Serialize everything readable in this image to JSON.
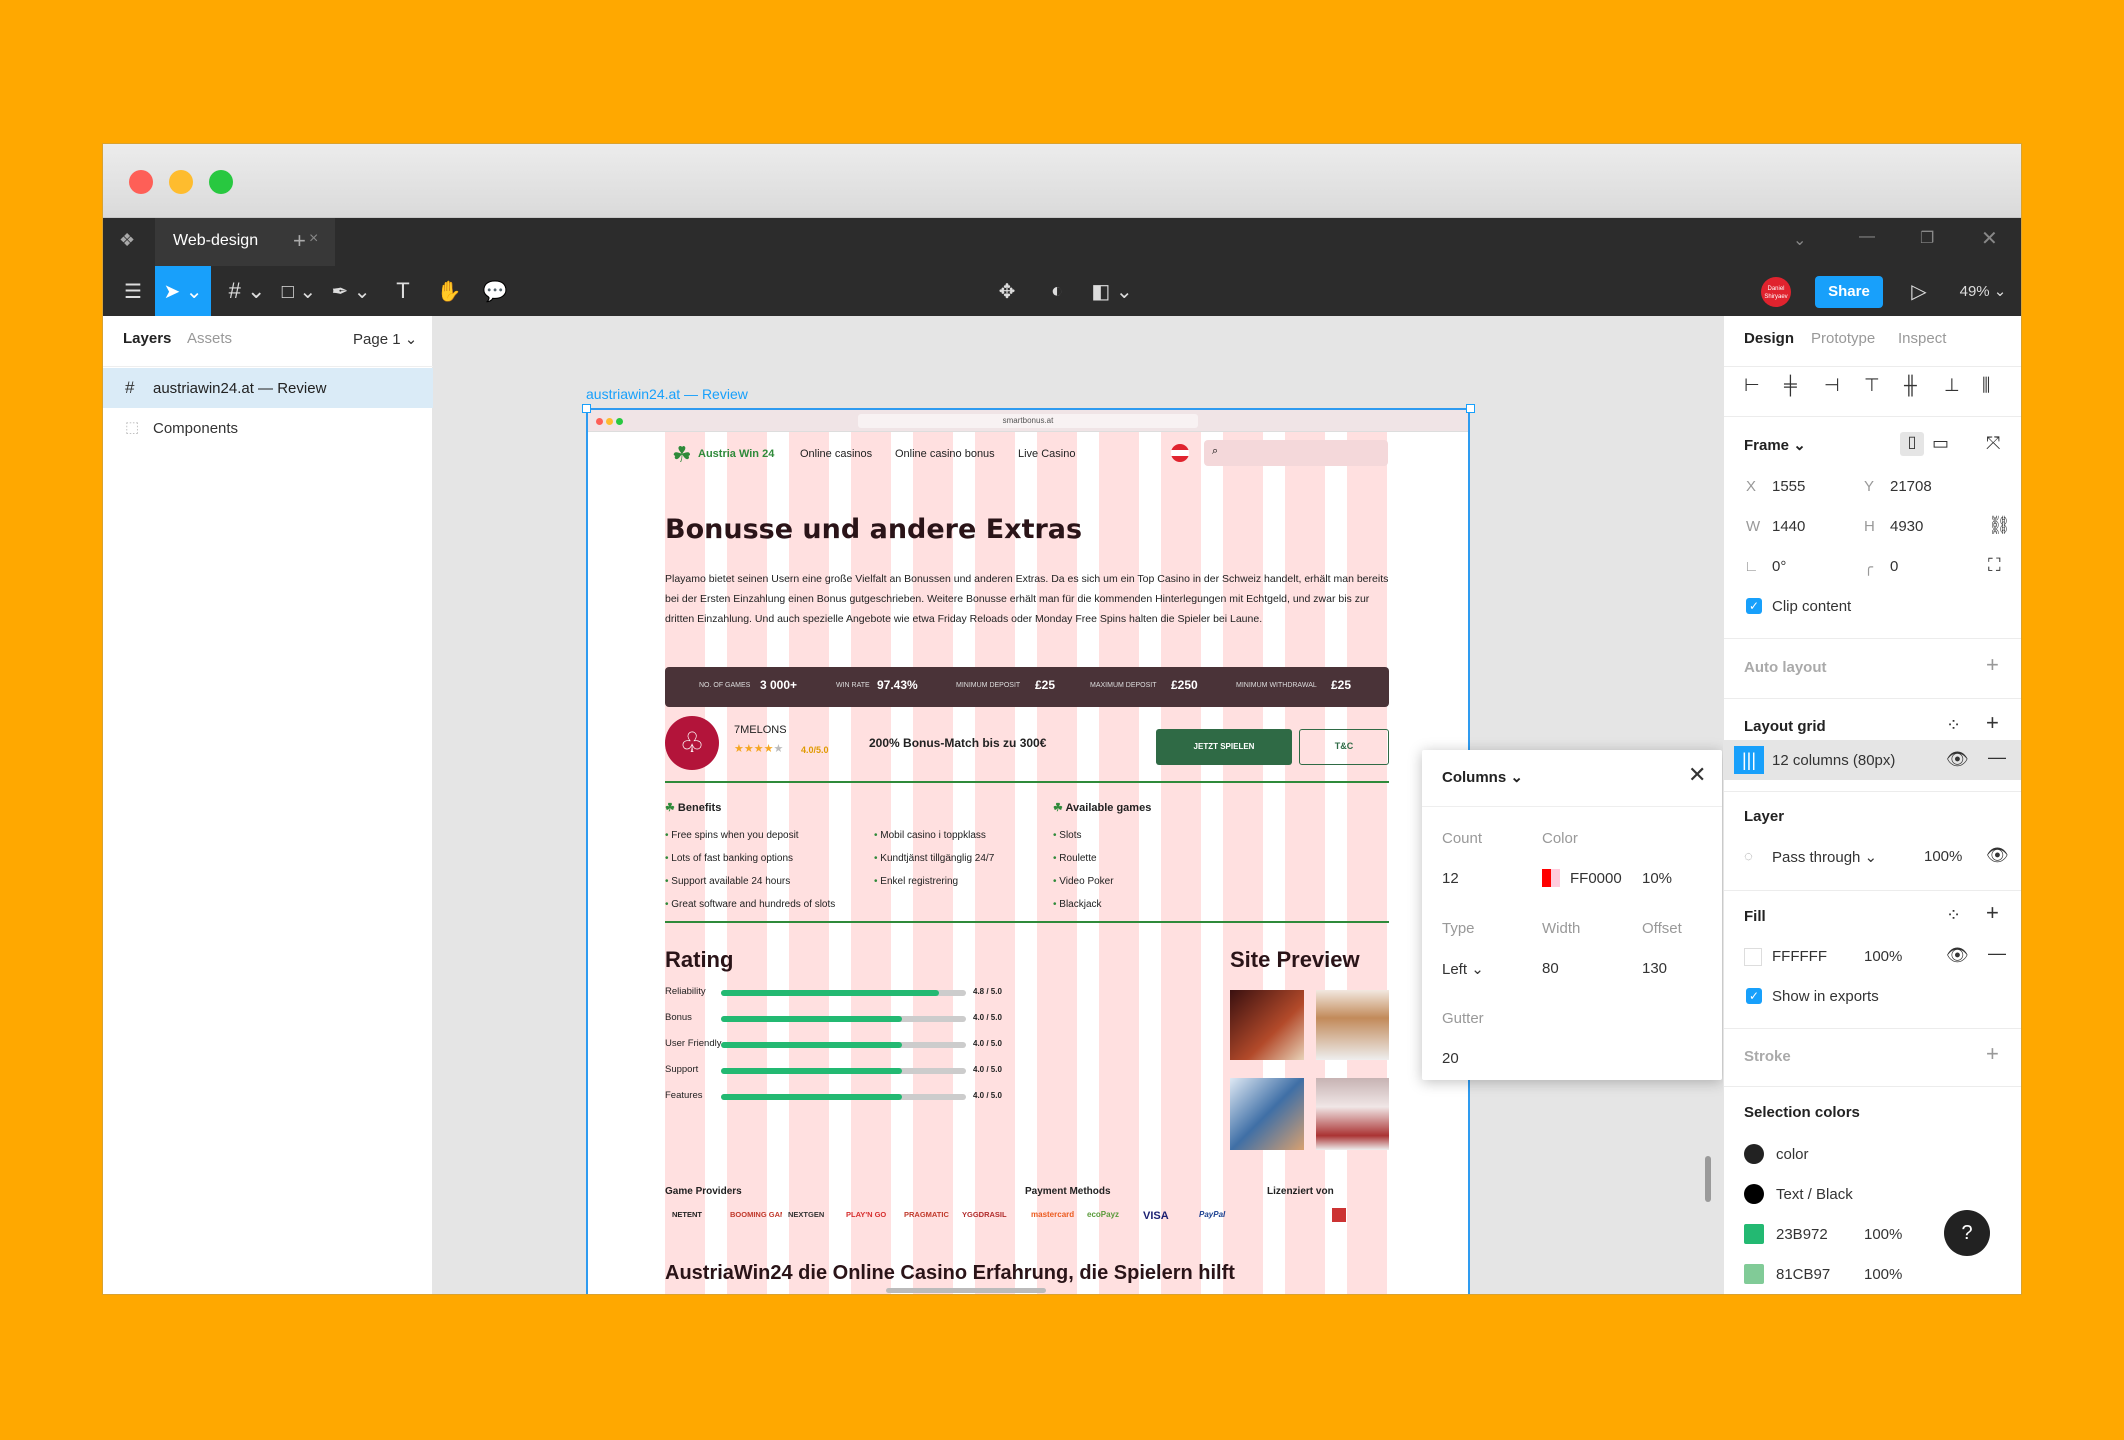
{
  "app": {
    "tab_title": "Web-design",
    "zoom": "49%",
    "share_label": "Share",
    "avatar_text": "Daniel Shiryaev"
  },
  "left_panel": {
    "tabs": [
      "Layers",
      "Assets"
    ],
    "page": "Page 1",
    "layers": [
      {
        "name": "austriawin24.at — Review",
        "selected": true
      },
      {
        "name": "Components",
        "selected": false
      }
    ]
  },
  "canvas": {
    "frame_label": "austriawin24.at — Review",
    "site": {
      "url": "smartbonus.at",
      "brand": "Austria Win 24",
      "nav": [
        "Online casinos",
        "Online casino bonus",
        "Live Casino"
      ],
      "heading": "Bonusse und andere Extras",
      "paragraph": "Playamo bietet seinen Usern eine große Vielfalt an Bonussen und anderen Extras. Da es sich um ein Top Casino in der Schweiz handelt, erhält man bereits bei der Ersten Einzahlung einen Bonus gutgeschrieben. Weitere Bonusse erhält man für die kommenden Hinterlegungen mit Echtgeld, und zwar bis zur dritten Einzahlung. Und auch spezielle Angebote wie etwa Friday Reloads oder Monday Free Spins halten die Spieler bei Laune.",
      "stats": [
        {
          "label": "NO. OF GAMES",
          "value": "3 000+"
        },
        {
          "label": "WIN RATE",
          "value": "97.43%"
        },
        {
          "label": "MINIMUM DEPOSIT",
          "value": "£25"
        },
        {
          "label": "MAXIMUM DEPOSIT",
          "value": "£250"
        },
        {
          "label": "MINIMUM WITHDRAWAL",
          "value": "£25"
        }
      ],
      "casino_name": "7MELONS",
      "casino_rating": "4.0/5.0",
      "offer": "200% Bonus-Match bis zu 300€",
      "cta_play": "JETZT SPIELEN",
      "cta_tc": "T&C",
      "benefits_title": "Benefits",
      "benefits_col1": [
        "Free spins when you deposit",
        "Lots of fast banking options",
        "Support available 24 hours",
        "Great software and hundreds of slots"
      ],
      "benefits_col2": [
        "Mobil casino i toppklass",
        "Kundtjänst tillgänglig 24/7",
        "Enkel registrering"
      ],
      "games_title": "Available games",
      "games": [
        "Slots",
        "Roulette",
        "Video Poker",
        "Blackjack"
      ],
      "rating_title": "Rating",
      "ratings": [
        {
          "label": "Reliability",
          "score": "4.8 / 5.0",
          "value": 4.8
        },
        {
          "label": "Bonus",
          "score": "4.0 / 5.0",
          "value": 4.0
        },
        {
          "label": "User Friendly",
          "score": "4.0 / 5.0",
          "value": 4.0
        },
        {
          "label": "Support",
          "score": "4.0 / 5.0",
          "value": 4.0
        },
        {
          "label": "Features",
          "score": "4.0 / 5.0",
          "value": 4.0
        }
      ],
      "preview_title": "Site Preview",
      "providers_title": "Game Providers",
      "providers": [
        "NETENT",
        "BOOMING GAMES",
        "NEXTGEN",
        "PLAY'N GO",
        "PRAGMATIC",
        "YGGDRASIL"
      ],
      "payments_title": "Payment Methods",
      "payments": [
        "mastercard",
        "ecoPayz",
        "VISA",
        "PayPal"
      ],
      "license_title": "Lizenziert von",
      "bottom_heading": "AustriaWin24 die Online Casino Erfahrung, die Spielern hilft"
    }
  },
  "columns_popup": {
    "title": "Columns",
    "count_label": "Count",
    "count": "12",
    "color_label": "Color",
    "color": "FF0000",
    "opacity": "10%",
    "type_label": "Type",
    "type": "Left",
    "width_label": "Width",
    "width": "80",
    "offset_label": "Offset",
    "offset": "130",
    "gutter_label": "Gutter",
    "gutter": "20"
  },
  "right_panel": {
    "tabs": [
      "Design",
      "Prototype",
      "Inspect"
    ],
    "frame_label": "Frame",
    "x": "1555",
    "y": "21708",
    "w": "1440",
    "h": "4930",
    "rotation": "0°",
    "radius": "0",
    "clip_content": "Clip content",
    "auto_layout": "Auto layout",
    "layout_grid": "Layout grid",
    "grid_item": "12 columns (80px)",
    "layer_title": "Layer",
    "blend": "Pass through",
    "layer_opacity": "100%",
    "fill_title": "Fill",
    "fill_hex": "FFFFFF",
    "fill_opacity": "100%",
    "show_exports": "Show in exports",
    "stroke_title": "Stroke",
    "selection_colors": "Selection colors",
    "colors": [
      {
        "name": "color",
        "swatch": "#222222",
        "opacity": ""
      },
      {
        "name": "Text / Black",
        "swatch": "#000000",
        "opacity": ""
      },
      {
        "name": "23B972",
        "swatch": "#23B972",
        "opacity": "100%"
      },
      {
        "name": "81CB97",
        "swatch": "#81CB97",
        "opacity": "100%"
      }
    ]
  },
  "colors": {
    "accent": "#18A0FB",
    "green": "#23B972",
    "dark_bar": "#4a3338",
    "avatar": "#E0232E"
  }
}
